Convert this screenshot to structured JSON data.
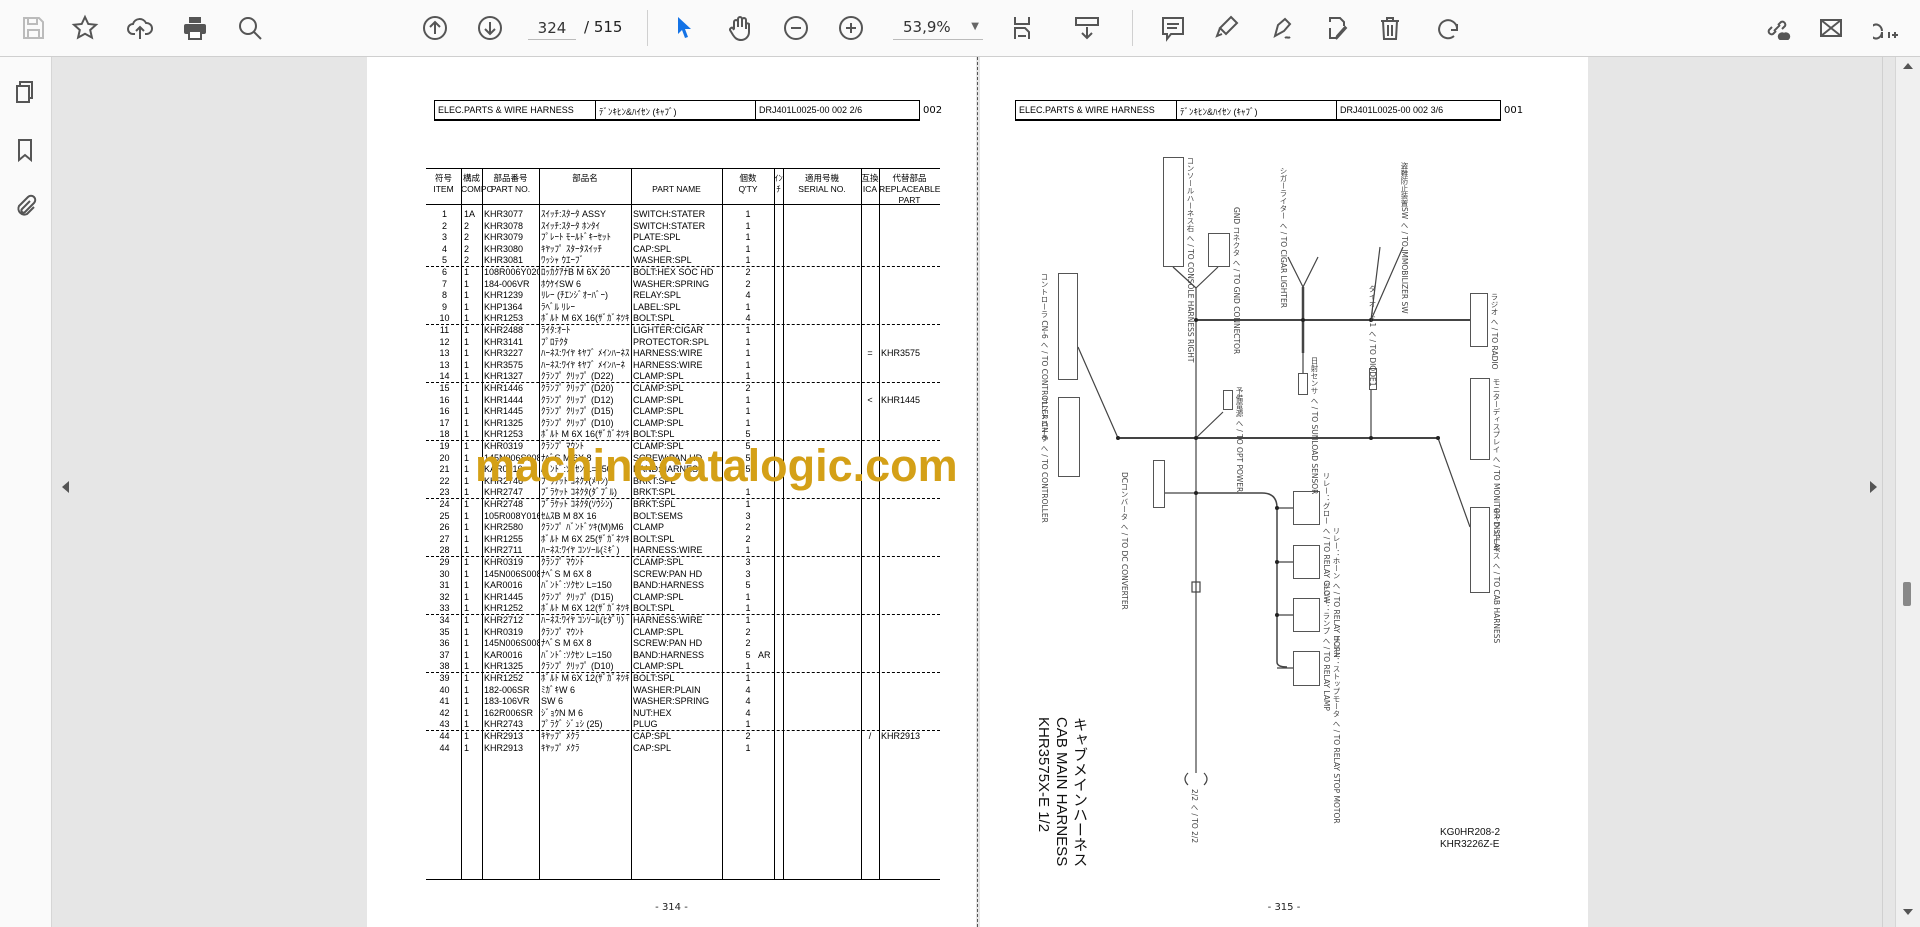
{
  "toolbar": {
    "current_page": "324",
    "total_pages": "/ 515",
    "zoom_level": "53,9%",
    "icons_left": [
      "save-icon",
      "bookmark-star-icon",
      "cloud-upload-icon",
      "print-icon",
      "find-icon"
    ],
    "icons_nav": [
      "page-up-icon",
      "page-down-icon"
    ],
    "icons_tools": [
      "select-cursor-icon",
      "hand-icon",
      "zoom-out-icon",
      "zoom-in-icon"
    ],
    "icons_right": [
      "comment-icon",
      "highlight-icon",
      "sign-icon",
      "edit-pdf-icon",
      "delete-icon",
      "rotate-icon",
      "share-link-icon",
      "mail-icon",
      "add-user-icon"
    ],
    "accent_color": "#1473e6"
  },
  "sidebar": {
    "icons": [
      "page-thumbnails-icon",
      "bookmarks-icon",
      "attachments-icon"
    ]
  },
  "left_page": {
    "header": [
      "ELEC.PARTS & WIRE HARNESS",
      "ﾃﾞﾝｷﾋﾝ&ﾊｲｾﾝ (ｷｬﾌﾞ)",
      "DRJ401L0025-00    002      2/6"
    ],
    "header_suffix": "002",
    "columns": [
      {
        "jp": "符号",
        "en": "ITEM"
      },
      {
        "jp": "構成",
        "en": "COMPO"
      },
      {
        "jp": "部品番号",
        "en": "PART NO."
      },
      {
        "jp": "部品名",
        "en": ""
      },
      {
        "jp": "",
        "en": "PART NAME"
      },
      {
        "jp": "個数",
        "en": "Q'TY"
      },
      {
        "jp": "ｲﾝﾁ",
        "en": ""
      },
      {
        "jp": "適用号機",
        "en": "SERIAL NO."
      },
      {
        "jp": "互換",
        "en": "ICA"
      },
      {
        "jp": "代替部品",
        "en": "REPLACEABLE PART"
      }
    ],
    "rows": [
      [
        "1",
        "1A",
        "KHR3077",
        "ｽｲｯﾁ:ｽﾀｰﾀ ASSY",
        "SWITCH:STATER",
        "1",
        "",
        "",
        ""
      ],
      [
        "2",
        "2",
        "KHR3078",
        "ｽｲｯﾁ:ｽﾀｰﾀ ﾎﾝﾀｲ",
        "SWITCH:STATER",
        "1",
        "",
        "",
        ""
      ],
      [
        "3",
        "2",
        "KHR3079",
        "ﾌﾟﾚｰﾄ ﾓｰﾙﾄﾞｷｰｾｯﾄ",
        "PLATE:SPL",
        "1",
        "",
        "",
        ""
      ],
      [
        "4",
        "2",
        "KHR3080",
        "ｷﾔｯﾌﾟ ｽﾀｰﾀｽｲｯﾁ",
        "CAP:SPL",
        "1",
        "",
        "",
        ""
      ],
      [
        "5",
        "2",
        "KHR3081",
        "ﾜｯｼｬ ｳｴｰﾌﾞ",
        "WASHER:SPL",
        "1",
        "",
        "",
        ""
      ],
      [
        "6",
        "1",
        "108R006Y020R",
        "ﾛｯｶｸｱﾅB M 6X 20",
        "BOLT:HEX SOC HD",
        "2",
        "",
        "",
        ""
      ],
      [
        "7",
        "1",
        "184-006VR",
        "ﾎｳｹｲSW  6",
        "WASHER:SPRING",
        "2",
        "",
        "",
        ""
      ],
      [
        "8",
        "1",
        "KHR1239",
        "ﾘﾚｰ (ﾁｴﾝｼﾞｵｰﾊﾞｰ)",
        "RELAY:SPL",
        "4",
        "",
        "",
        ""
      ],
      [
        "9",
        "1",
        "KHP1364",
        "ﾗﾍﾞﾙ ﾘﾚｰ",
        "LABEL:SPL",
        "1",
        "",
        "",
        ""
      ],
      [
        "10",
        "1",
        "KHR1253",
        "ﾎﾞﾙﾄ M 6X 16(ｻﾞｶﾞﾈﾂｷ",
        "BOLT:SPL",
        "4",
        "",
        "",
        ""
      ],
      [
        "11",
        "1",
        "KHR2488",
        "ﾗｲﾀ:ｵｰﾄ",
        "LIGHTER:CIGAR",
        "1",
        "",
        "",
        ""
      ],
      [
        "12",
        "1",
        "KHR3141",
        "ﾌﾟﾛﾃｸﾀ",
        "PROTECTOR:SPL",
        "1",
        "",
        "",
        ""
      ],
      [
        "13",
        "1",
        "KHR3227",
        "ﾊｰﾈｽ:ﾜｲﾔ ｷﾔﾌﾞ ﾒｲﾝﾊｰﾈｽ",
        "HARNESS:WIRE",
        "1",
        "",
        "=",
        "KHR3575"
      ],
      [
        "13",
        "1",
        "KHR3575",
        "ﾊｰﾈｽ:ﾜｲﾔ ｷﾔﾌﾞ ﾒｲﾝﾊｰﾈ",
        "HARNESS:WIRE",
        "1",
        "",
        "",
        ""
      ],
      [
        "14",
        "1",
        "KHR1327",
        "ｸﾗﾝﾌﾟ ｸﾘｯﾌﾟ (D22)",
        "CLAMP:SPL",
        "1",
        "",
        "",
        ""
      ],
      [
        "15",
        "1",
        "KHR1446",
        "ｸﾗﾝﾌﾟ ｸﾘｯﾌﾟ (D20)",
        "CLAMP:SPL",
        "2",
        "",
        "",
        ""
      ],
      [
        "16",
        "1",
        "KHR1444",
        "ｸﾗﾝﾌﾟ ｸﾘｯﾌﾟ (D12)",
        "CLAMP:SPL",
        "1",
        "",
        "<",
        "KHR1445"
      ],
      [
        "16",
        "1",
        "KHR1445",
        "ｸﾗﾝﾌﾟ ｸﾘｯﾌﾟ (D15)",
        "CLAMP:SPL",
        "1",
        "",
        "",
        ""
      ],
      [
        "17",
        "1",
        "KHR1325",
        "ｸﾗﾝﾌﾟ ｸﾘｯﾌﾟ (D10)",
        "CLAMP:SPL",
        "1",
        "",
        "",
        ""
      ],
      [
        "18",
        "1",
        "KHR1253",
        "ﾎﾞﾙﾄ M 6X 16(ｻﾞｶﾞﾈﾂｷ",
        "BOLT:SPL",
        "5",
        "",
        "",
        ""
      ],
      [
        "19",
        "1",
        "KHR0319",
        "ｸﾗﾝﾌﾟ ﾏｳﾝﾄ",
        "CLAMP:SPL",
        "5",
        "",
        "",
        ""
      ],
      [
        "20",
        "1",
        "145N006S008R",
        "ﾅﾍﾞS M 6X  8",
        "SCREW:PAN HD",
        "5",
        "",
        "",
        ""
      ],
      [
        "21",
        "1",
        "KAR0016",
        "ﾊﾞﾝﾄﾞ:ｿｸｾﾝ  L=150",
        "BAND:HARNESS",
        "5",
        "",
        "",
        ""
      ],
      [
        "22",
        "1",
        "KHR2746",
        "ﾌﾞﾗｹｯﾄ ｺﾈｸﾀ(ﾒｲﾝ)",
        "BRKT:SPL",
        "",
        "",
        "",
        ""
      ],
      [
        "23",
        "1",
        "KHR2747",
        "ﾌﾞﾗｹｯﾄ ｺﾈｸﾀ(ﾀﾞﾌﾞﾙ)",
        "BRKT:SPL",
        "1",
        "",
        "",
        ""
      ],
      [
        "24",
        "1",
        "KHR2748",
        "ﾌﾞﾗｹｯﾄ ｺﾈｸﾀ(ｿｳｼﾝ)",
        "BRKT:SPL",
        "1",
        "",
        "",
        ""
      ],
      [
        "25",
        "1",
        "105R008Y016R",
        "ｾﾑｽB M 8X 16",
        "BOLT:SEMS",
        "3",
        "",
        "",
        ""
      ],
      [
        "26",
        "1",
        "KHR2580",
        "ｸﾗﾝﾌﾟ ﾊﾞﾝﾄﾞﾂｷ(M)M6",
        "CLAMP",
        "2",
        "",
        "",
        ""
      ],
      [
        "27",
        "1",
        "KHR1255",
        "ﾎﾞﾙﾄ M 6X 25(ｻﾞｶﾞﾈﾂｷ",
        "BOLT:SPL",
        "2",
        "",
        "",
        ""
      ],
      [
        "28",
        "1",
        "KHR2711",
        "ﾊｰﾈｽ:ﾜｲﾔ ｺﾝｿｰﾙ(ﾐｷﾞ)",
        "HARNESS:WIRE",
        "1",
        "",
        "",
        ""
      ],
      [
        "29",
        "1",
        "KHR0319",
        "ｸﾗﾝﾌﾟ ﾏｳﾝﾄ",
        "CLAMP:SPL",
        "3",
        "",
        "",
        ""
      ],
      [
        "30",
        "1",
        "145N006S008R",
        "ﾅﾍﾞS M 6X  8",
        "SCREW:PAN HD",
        "3",
        "",
        "",
        ""
      ],
      [
        "31",
        "1",
        "KAR0016",
        "ﾊﾞﾝﾄﾞ:ｿｸｾﾝ  L=150",
        "BAND:HARNESS",
        "5",
        "",
        "",
        ""
      ],
      [
        "32",
        "1",
        "KHR1445",
        "ｸﾗﾝﾌﾟ ｸﾘｯﾌﾟ (D15)",
        "CLAMP:SPL",
        "1",
        "",
        "",
        ""
      ],
      [
        "33",
        "1",
        "KHR1252",
        "ﾎﾞﾙﾄ M 6X 12(ｻﾞｶﾞﾈﾂｷ",
        "BOLT:SPL",
        "1",
        "",
        "",
        ""
      ],
      [
        "34",
        "1",
        "KHR2712",
        "ﾊｰﾈｽ:ﾜｲﾔ ｺﾝｿｰﾙ(ﾋﾀﾞﾘ)",
        "HARNESS:WIRE",
        "1",
        "",
        "",
        ""
      ],
      [
        "35",
        "1",
        "KHR0319",
        "ｸﾗﾝﾌﾟ ﾏｳﾝﾄ",
        "CLAMP:SPL",
        "2",
        "",
        "",
        ""
      ],
      [
        "36",
        "1",
        "145N006S008R",
        "ﾅﾍﾞS M 6X  8",
        "SCREW:PAN HD",
        "2",
        "",
        "",
        ""
      ],
      [
        "37",
        "1",
        "KAR0016",
        "ﾊﾞﾝﾄﾞ:ｿｸｾﾝ  L=150",
        "BAND:HARNESS",
        "5",
        "AR",
        "",
        ""
      ],
      [
        "38",
        "1",
        "KHR1325",
        "ｸﾗﾝﾌﾟ ｸﾘｯﾌﾟ (D10)",
        "CLAMP:SPL",
        "1",
        "",
        "",
        ""
      ],
      [
        "39",
        "1",
        "KHR1252",
        "ﾎﾞﾙﾄ M 6X 12(ｻﾞｶﾞﾈﾂｷ",
        "BOLT:SPL",
        "1",
        "",
        "",
        ""
      ],
      [
        "40",
        "1",
        "182-006SR",
        "ﾐｶﾞｷW  6",
        "WASHER:PLAIN",
        "4",
        "",
        "",
        ""
      ],
      [
        "41",
        "1",
        "183-106VR",
        "SW  6",
        "WASHER:SPRING",
        "4",
        "",
        "",
        ""
      ],
      [
        "42",
        "1",
        "162R006SR",
        "ｼﾞｮｳN M 6",
        "NUT:HEX",
        "4",
        "",
        "",
        ""
      ],
      [
        "43",
        "1",
        "KHR2743",
        "ﾌﾟﾗｸﾞ ｼﾞｭｼ (25)",
        "PLUG",
        "1",
        "",
        "",
        ""
      ],
      [
        "44",
        "1",
        "KHR2913",
        "ｷﾔｯﾌﾟ ﾒｸﾗ",
        "CAP:SPL",
        "2",
        "",
        "/",
        "KHR2913"
      ],
      [
        "44",
        "1",
        "KHR2913",
        "ｷﾔｯﾌﾟ ﾒｸﾗ",
        "CAP:SPL",
        "1",
        "",
        "",
        ""
      ]
    ],
    "page_number": "- 314 -"
  },
  "right_page": {
    "header": [
      "ELEC.PARTS & WIRE HARNESS",
      "ﾃﾞﾝｷﾋﾝ&ﾊｲｾﾝ (ｷｬﾌﾞ)",
      "DRJ401L0025-00    002      3/6"
    ],
    "header_suffix": "001",
    "connector_labels": {
      "console": "コンソールハーネス右 へ / TO CONSOLE HARNESS RIGHT",
      "gnd": "GND コネクタ へ / TO GND CONNECTOR",
      "cigar": "シガーライター へ / TO CIGAR LIGHTER",
      "immobilizer": "盗難防止装置SW へ / TO IMMOBILIZER SW",
      "radio": "ラジオ へ / TO RADIO",
      "controller6": "コントローラ CN-6 へ / TO CONTROLLER CN-6",
      "controller": "コントローラ へ / TO CONTROLLER",
      "sunload": "日射センサ へ / TO SUNLOAD SENSOR",
      "diode": "ダイオード1 へ / TO DIODE1",
      "opt_power": "予備電源 へ / TO OPT POWER",
      "monitor": "モニターディスプレイ へ / TO MONITOR DISPLAY",
      "cab_harness": "キャブハーネス へ / TO CAB HARNESS",
      "dc_converter": "DCコンバータ へ / TO DC CONVERTER",
      "relay_glow": "リレー：グロー へ / TO RELAY GLOW",
      "relay_horn": "リレー：ホーン へ / TO RELAY HORN",
      "relay_lamp": "リレー：ランプ へ / TO RELAY LAMP",
      "relay_stop": "リレー：ストップモータ へ / TO RELAY STOP MOTOR",
      "to22": "2/2 へ / TO 2/2"
    },
    "title_jp": "キャブメインハーネス",
    "title_en": "CAB MAIN HARNESS",
    "title_part": "KHR3575X-E 1/2",
    "code1": "KG0HR208-2",
    "code2": "KHR3226Z-E",
    "page_number": "- 315 -"
  },
  "watermark": "machinecatalogic.com",
  "watermark_color": "#d4a017"
}
